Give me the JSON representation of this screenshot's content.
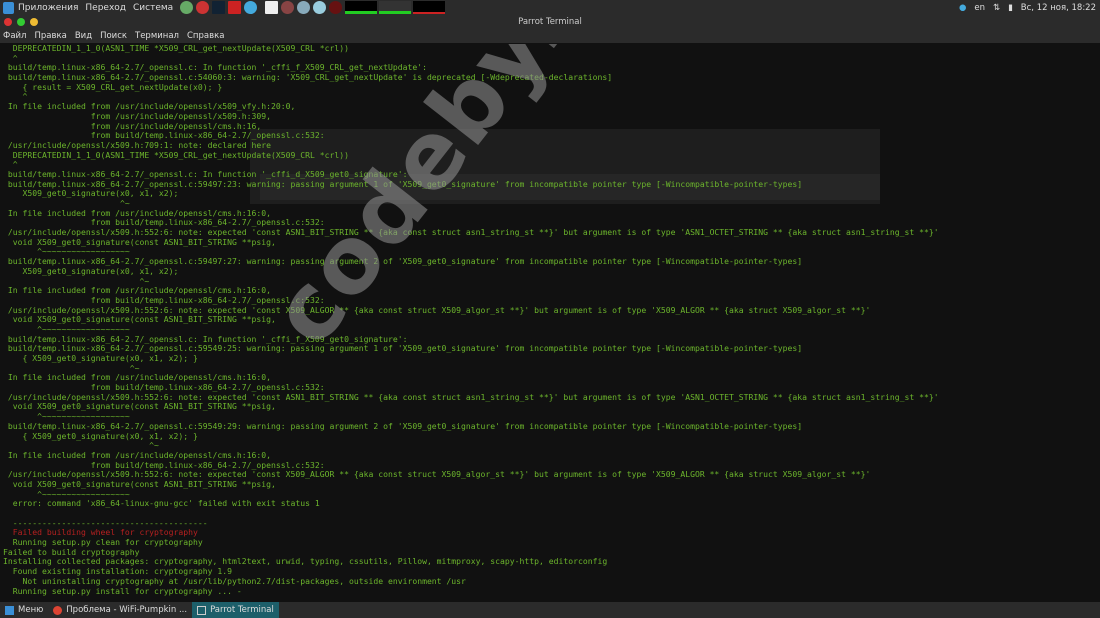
{
  "top_panel": {
    "menus": [
      "Приложения",
      "Переход",
      "Система"
    ],
    "lang": "en",
    "datetime": "Вс, 12 ноя, 18:22"
  },
  "window": {
    "title": "Parrot Terminal",
    "menu": [
      "Файл",
      "Правка",
      "Вид",
      "Поиск",
      "Терминал",
      "Справка"
    ]
  },
  "terminal_lines": [
    {
      "t": "  DEPRECATEDIN_1_1_0(ASN1_TIME *X509_CRL_get_nextUpdate(X509_CRL *crl))",
      "c": ""
    },
    {
      "t": "  ^",
      "c": ""
    },
    {
      "t": " build/temp.linux-x86_64-2.7/_openssl.c: In function '_cffi_f_X509_CRL_get_nextUpdate':",
      "c": ""
    },
    {
      "t": " build/temp.linux-x86_64-2.7/_openssl.c:54060:3: warning: 'X509_CRL_get_nextUpdate' is deprecated [-Wdeprecated-declarations]",
      "c": ""
    },
    {
      "t": "    { result = X509_CRL_get_nextUpdate(x0); }",
      "c": ""
    },
    {
      "t": "    ^",
      "c": ""
    },
    {
      "t": " In file included from /usr/include/openssl/x509_vfy.h:20:0,",
      "c": ""
    },
    {
      "t": "                  from /usr/include/openssl/x509.h:309,",
      "c": ""
    },
    {
      "t": "                  from /usr/include/openssl/cms.h:16,",
      "c": ""
    },
    {
      "t": "                  from build/temp.linux-x86_64-2.7/_openssl.c:532:",
      "c": ""
    },
    {
      "t": " /usr/include/openssl/x509.h:709:1: note: declared here",
      "c": ""
    },
    {
      "t": "  DEPRECATEDIN_1_1_0(ASN1_TIME *X509_CRL_get_nextUpdate(X509_CRL *crl))",
      "c": ""
    },
    {
      "t": "  ^",
      "c": ""
    },
    {
      "t": " build/temp.linux-x86_64-2.7/_openssl.c: In function '_cffi_d_X509_get0_signature':",
      "c": ""
    },
    {
      "t": " build/temp.linux-x86_64-2.7/_openssl.c:59497:23: warning: passing argument 1 of 'X509_get0_signature' from incompatible pointer type [-Wincompatible-pointer-types]",
      "c": ""
    },
    {
      "t": "    X509_get0_signature(x0, x1, x2);",
      "c": ""
    },
    {
      "t": "                        ^~",
      "c": ""
    },
    {
      "t": " In file included from /usr/include/openssl/cms.h:16:0,",
      "c": ""
    },
    {
      "t": "                  from build/temp.linux-x86_64-2.7/_openssl.c:532:",
      "c": ""
    },
    {
      "t": " /usr/include/openssl/x509.h:552:6: note: expected 'const ASN1_BIT_STRING ** {aka const struct asn1_string_st **}' but argument is of type 'ASN1_OCTET_STRING ** {aka struct asn1_string_st **}'",
      "c": ""
    },
    {
      "t": "  void X509_get0_signature(const ASN1_BIT_STRING **psig,",
      "c": ""
    },
    {
      "t": "       ^~~~~~~~~~~~~~~~~~~",
      "c": ""
    },
    {
      "t": " build/temp.linux-x86_64-2.7/_openssl.c:59497:27: warning: passing argument 2 of 'X509_get0_signature' from incompatible pointer type [-Wincompatible-pointer-types]",
      "c": ""
    },
    {
      "t": "    X509_get0_signature(x0, x1, x2);",
      "c": ""
    },
    {
      "t": "                            ^~",
      "c": ""
    },
    {
      "t": " In file included from /usr/include/openssl/cms.h:16:0,",
      "c": ""
    },
    {
      "t": "                  from build/temp.linux-x86_64-2.7/_openssl.c:532:",
      "c": ""
    },
    {
      "t": " /usr/include/openssl/x509.h:552:6: note: expected 'const X509_ALGOR ** {aka const struct X509_algor_st **}' but argument is of type 'X509_ALGOR ** {aka struct X509_algor_st **}'",
      "c": ""
    },
    {
      "t": "  void X509_get0_signature(const ASN1_BIT_STRING **psig,",
      "c": ""
    },
    {
      "t": "       ^~~~~~~~~~~~~~~~~~~",
      "c": ""
    },
    {
      "t": " build/temp.linux-x86_64-2.7/_openssl.c: In function '_cffi_f_X509_get0_signature':",
      "c": ""
    },
    {
      "t": " build/temp.linux-x86_64-2.7/_openssl.c:59549:25: warning: passing argument 1 of 'X509_get0_signature' from incompatible pointer type [-Wincompatible-pointer-types]",
      "c": ""
    },
    {
      "t": "    { X509_get0_signature(x0, x1, x2); }",
      "c": ""
    },
    {
      "t": "                          ^~",
      "c": ""
    },
    {
      "t": " In file included from /usr/include/openssl/cms.h:16:0,",
      "c": ""
    },
    {
      "t": "                  from build/temp.linux-x86_64-2.7/_openssl.c:532:",
      "c": ""
    },
    {
      "t": " /usr/include/openssl/x509.h:552:6: note: expected 'const ASN1_BIT_STRING ** {aka const struct asn1_string_st **}' but argument is of type 'ASN1_OCTET_STRING ** {aka struct asn1_string_st **}'",
      "c": ""
    },
    {
      "t": "  void X509_get0_signature(const ASN1_BIT_STRING **psig,",
      "c": ""
    },
    {
      "t": "       ^~~~~~~~~~~~~~~~~~~",
      "c": ""
    },
    {
      "t": " build/temp.linux-x86_64-2.7/_openssl.c:59549:29: warning: passing argument 2 of 'X509_get0_signature' from incompatible pointer type [-Wincompatible-pointer-types]",
      "c": ""
    },
    {
      "t": "    { X509_get0_signature(x0, x1, x2); }",
      "c": ""
    },
    {
      "t": "                              ^~",
      "c": ""
    },
    {
      "t": " In file included from /usr/include/openssl/cms.h:16:0,",
      "c": ""
    },
    {
      "t": "                  from build/temp.linux-x86_64-2.7/_openssl.c:532:",
      "c": ""
    },
    {
      "t": " /usr/include/openssl/x509.h:552:6: note: expected 'const X509_ALGOR ** {aka const struct X509_algor_st **}' but argument is of type 'X509_ALGOR ** {aka struct X509_algor_st **}'",
      "c": ""
    },
    {
      "t": "  void X509_get0_signature(const ASN1_BIT_STRING **psig,",
      "c": ""
    },
    {
      "t": "       ^~~~~~~~~~~~~~~~~~~",
      "c": ""
    },
    {
      "t": "  error: command 'x86_64-linux-gnu-gcc' failed with exit status 1",
      "c": ""
    },
    {
      "t": "",
      "c": ""
    },
    {
      "t": "  ----------------------------------------",
      "c": ""
    },
    {
      "t": "  Failed building wheel for cryptography",
      "c": "red"
    },
    {
      "t": "  Running setup.py clean for cryptography",
      "c": ""
    },
    {
      "t": "Failed to build cryptography",
      "c": ""
    },
    {
      "t": "Installing collected packages: cryptography, html2text, urwid, typing, cssutils, Pillow, mitmproxy, scapy-http, editorconfig",
      "c": ""
    },
    {
      "t": "  Found existing installation: cryptography 1.9",
      "c": ""
    },
    {
      "t": "    Not uninstalling cryptography at /usr/lib/python2.7/dist-packages, outside environment /usr",
      "c": ""
    },
    {
      "t": "  Running setup.py install for cryptography ... -",
      "c": ""
    }
  ],
  "watermark": "codeby.net",
  "taskbar": {
    "menu": "Меню",
    "tasks": [
      "Проблема - WiFi-Pumpkin ...",
      "Parrot Terminal"
    ]
  }
}
